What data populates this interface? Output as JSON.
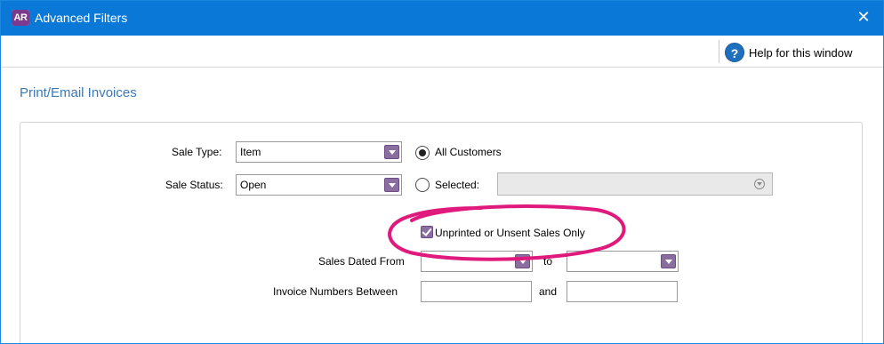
{
  "window": {
    "app_badge": "AR",
    "title": "Advanced Filters",
    "close_glyph": "✕"
  },
  "helpbar": {
    "help_icon": "?",
    "help_label": "Help for this window"
  },
  "page": {
    "title": "Print/Email Invoices"
  },
  "filters": {
    "sale_type_label": "Sale Type:",
    "sale_type_value": "Item",
    "sale_status_label": "Sale Status:",
    "sale_status_value": "Open",
    "all_customers_label": "All Customers",
    "all_customers_selected": true,
    "selected_label": "Selected:",
    "selected_selected": false,
    "selected_customer_value": "",
    "unprinted_label": "Unprinted or Unsent Sales Only",
    "unprinted_checked": true,
    "sales_dated_from_label": "Sales Dated From",
    "sales_dated_from_value": "",
    "to_label": "to",
    "sales_dated_to_value": "",
    "invoice_numbers_label": "Invoice Numbers Between",
    "invoice_from_value": "",
    "and_label": "and",
    "invoice_to_value": ""
  },
  "colors": {
    "titlebar": "#0a78d7",
    "accent_purple": "#8a6ea0",
    "highlight_magenta": "#e0197d",
    "page_title_blue": "#3b79b5"
  },
  "icons": {
    "close": "close-icon",
    "help": "help-icon",
    "dropdown": "chevron-down-icon",
    "combo": "circle-chevron-down-icon",
    "check": "check-icon"
  }
}
